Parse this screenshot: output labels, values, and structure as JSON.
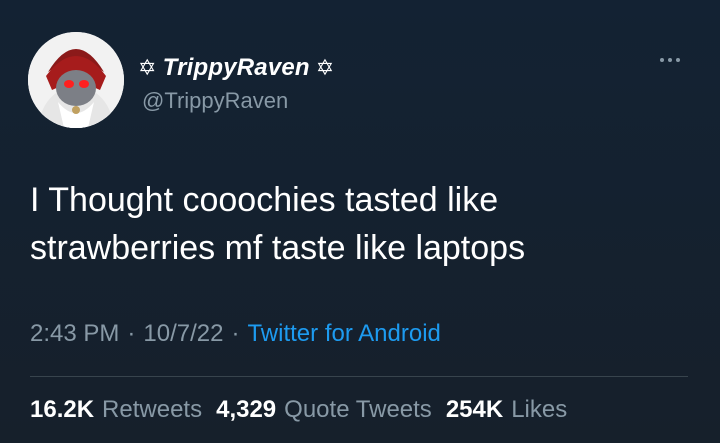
{
  "tweet": {
    "display_name": "TrippyRaven",
    "name_icon_left": "pentagram-icon",
    "name_icon_right": "pentagram-icon",
    "handle": "@TrippyRaven",
    "text_lines": [
      "I Thought cooochies tasted like",
      "strawberries mf taste like laptops"
    ],
    "time": "2:43 PM",
    "separator": "·",
    "date": "10/7/22",
    "source": "Twitter for Android",
    "retweets_count": "16.2K",
    "retweets_label": "Retweets",
    "quotes_count": "4,329",
    "quotes_label": "Quote Tweets",
    "likes_count": "254K",
    "likes_label": "Likes"
  },
  "colors": {
    "background": "#16202b",
    "muted": "#8899a6",
    "link": "#1d9bf0",
    "text": "#ffffff"
  }
}
